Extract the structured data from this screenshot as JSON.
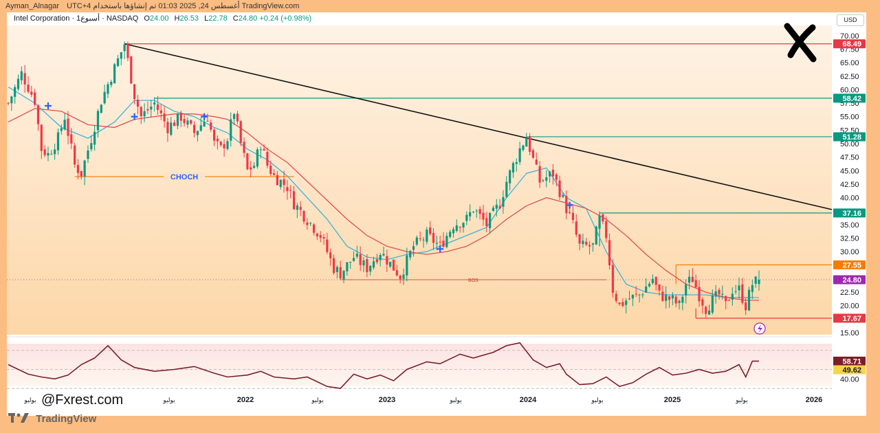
{
  "header": {
    "user": "Ayman_Alnagar",
    "info": "UTC+4 أغسطس 24, 2025 01:03 تم إنشاؤها باستخدام TradingView.com"
  },
  "legend": {
    "symbol": "Intel Corporation · 1أسبوع · NASDAQ",
    "o_label": "O",
    "o": "24.00",
    "h_label": "H",
    "h": "26.53",
    "l_label": "L",
    "l": "22.78",
    "c_label": "C",
    "c": "24.80",
    "change": "+0.24 (+0.98%)"
  },
  "currency": "USD",
  "watermark": "@Fxrest.com",
  "footer_brand": "TradingView",
  "colors": {
    "up": "#089981",
    "down": "#f23645",
    "ma_fast": "#3bb3d9",
    "ma_slow": "#e05050",
    "rsi": "#7b1e2a",
    "level_red": "#e53945",
    "level_teal": "#089981",
    "level_orange": "#f57c00"
  },
  "chart_data": {
    "type": "candlestick",
    "ylim": [
      15,
      71
    ],
    "y_ticks": [
      "15.00",
      "17.50",
      "20.00",
      "22.50",
      "25.00",
      "27.50",
      "30.00",
      "32.50",
      "35.00",
      "37.50",
      "40.00",
      "42.50",
      "45.00",
      "47.50",
      "50.00",
      "52.50",
      "55.00",
      "57.50",
      "60.00",
      "62.50",
      "65.00",
      "67.50",
      "70.00"
    ],
    "x_ticks": [
      "يوليو",
      "يوليو",
      "2022",
      "يوليو",
      "2023",
      "يوليو",
      "2024",
      "يوليو",
      "2025",
      "يوليو",
      "2026"
    ],
    "price_labels": [
      {
        "text": "68.49",
        "value": 68.49,
        "color": "#e53945"
      },
      {
        "text": "58.42",
        "value": 58.42,
        "color": "#089981"
      },
      {
        "text": "51.28",
        "value": 51.28,
        "color": "#089981"
      },
      {
        "text": "37.16",
        "value": 37.16,
        "color": "#089981"
      },
      {
        "text": "27.55",
        "value": 27.55,
        "color": "#f57c00"
      },
      {
        "text": "24.80",
        "value": 24.8,
        "color": "#9c27b0"
      },
      {
        "text": "17.67",
        "value": 17.67,
        "color": "#e53945"
      }
    ],
    "annotations": [
      {
        "text": "CHOCH",
        "value": 43.9
      },
      {
        "text": "BOS",
        "value": 24.8
      }
    ],
    "price_path": [
      [
        0,
        57.5
      ],
      [
        4,
        63
      ],
      [
        8,
        58
      ],
      [
        10,
        49
      ],
      [
        12,
        48
      ],
      [
        15,
        51
      ],
      [
        17,
        55
      ],
      [
        20,
        46
      ],
      [
        22,
        44.5
      ],
      [
        25,
        51
      ],
      [
        28,
        58
      ],
      [
        32,
        64
      ],
      [
        35,
        68.49
      ],
      [
        38,
        59
      ],
      [
        40,
        55
      ],
      [
        44,
        57.5
      ],
      [
        48,
        53
      ],
      [
        52,
        55
      ],
      [
        56,
        52
      ],
      [
        60,
        55
      ],
      [
        62,
        50
      ],
      [
        64,
        49
      ],
      [
        66,
        51
      ],
      [
        68,
        56
      ],
      [
        70,
        50
      ],
      [
        72,
        45
      ],
      [
        74,
        46
      ],
      [
        76,
        50
      ],
      [
        78,
        46
      ],
      [
        80,
        44
      ],
      [
        82,
        43
      ],
      [
        84,
        42
      ],
      [
        86,
        39
      ],
      [
        90,
        36
      ],
      [
        94,
        33
      ],
      [
        96,
        30
      ],
      [
        98,
        27
      ],
      [
        100,
        26
      ],
      [
        104,
        29
      ],
      [
        108,
        27
      ],
      [
        112,
        30
      ],
      [
        116,
        27
      ],
      [
        118,
        25.5
      ],
      [
        122,
        31
      ],
      [
        126,
        33
      ],
      [
        130,
        31
      ],
      [
        134,
        35
      ],
      [
        138,
        36
      ],
      [
        140,
        38
      ],
      [
        144,
        35
      ],
      [
        148,
        39
      ],
      [
        150,
        43
      ],
      [
        154,
        49
      ],
      [
        156,
        51.28
      ],
      [
        158,
        47
      ],
      [
        160,
        43
      ],
      [
        164,
        44.5
      ],
      [
        168,
        38
      ],
      [
        170,
        35
      ],
      [
        172,
        31
      ],
      [
        176,
        31
      ],
      [
        178,
        36
      ],
      [
        180,
        33
      ],
      [
        182,
        23
      ],
      [
        184,
        20
      ],
      [
        186,
        21
      ],
      [
        190,
        22
      ],
      [
        194,
        25
      ],
      [
        196,
        22
      ],
      [
        200,
        21
      ],
      [
        202,
        20
      ],
      [
        204,
        24
      ],
      [
        206,
        25
      ],
      [
        208,
        22
      ],
      [
        210,
        19.5
      ],
      [
        212,
        21
      ],
      [
        214,
        22
      ],
      [
        216,
        20
      ],
      [
        218,
        23
      ],
      [
        220,
        23
      ],
      [
        222,
        20
      ],
      [
        224,
        24
      ],
      [
        226,
        24.8
      ]
    ],
    "series": [
      {
        "name": "MA fast",
        "values": [
          [
            0,
            60.5
          ],
          [
            8,
            57.5
          ],
          [
            16,
            53
          ],
          [
            24,
            51
          ],
          [
            32,
            54
          ],
          [
            38,
            58
          ],
          [
            44,
            58
          ],
          [
            50,
            56
          ],
          [
            56,
            55
          ],
          [
            62,
            53
          ],
          [
            66,
            52
          ],
          [
            72,
            49
          ],
          [
            78,
            47
          ],
          [
            84,
            44
          ],
          [
            90,
            40
          ],
          [
            96,
            36
          ],
          [
            102,
            31
          ],
          [
            108,
            29
          ],
          [
            114,
            28.5
          ],
          [
            120,
            29.5
          ],
          [
            126,
            30
          ],
          [
            132,
            31.5
          ],
          [
            138,
            33
          ],
          [
            144,
            34.5
          ],
          [
            150,
            40
          ],
          [
            156,
            44.5
          ],
          [
            162,
            45.5
          ],
          [
            168,
            40
          ],
          [
            174,
            38
          ],
          [
            180,
            30
          ],
          [
            186,
            24
          ],
          [
            192,
            22.5
          ],
          [
            198,
            22
          ],
          [
            204,
            22
          ],
          [
            210,
            22
          ],
          [
            216,
            21.5
          ],
          [
            222,
            21.5
          ],
          [
            226,
            21.5
          ]
        ]
      },
      {
        "name": "MA slow",
        "values": [
          [
            0,
            54
          ],
          [
            8,
            56.5
          ],
          [
            16,
            56
          ],
          [
            24,
            53.5
          ],
          [
            32,
            53
          ],
          [
            38,
            54.5
          ],
          [
            44,
            55
          ],
          [
            50,
            55.5
          ],
          [
            56,
            55.5
          ],
          [
            62,
            55
          ],
          [
            66,
            54.5
          ],
          [
            72,
            52
          ],
          [
            78,
            49
          ],
          [
            84,
            46.5
          ],
          [
            90,
            43
          ],
          [
            96,
            39.5
          ],
          [
            102,
            36
          ],
          [
            108,
            33
          ],
          [
            114,
            31
          ],
          [
            120,
            30
          ],
          [
            126,
            29.5
          ],
          [
            132,
            30
          ],
          [
            138,
            31
          ],
          [
            144,
            33
          ],
          [
            150,
            36
          ],
          [
            156,
            38.5
          ],
          [
            162,
            40
          ],
          [
            168,
            39
          ],
          [
            174,
            38
          ],
          [
            180,
            36
          ],
          [
            186,
            33
          ],
          [
            192,
            29.5
          ],
          [
            198,
            26.5
          ],
          [
            204,
            24
          ],
          [
            210,
            22.5
          ],
          [
            216,
            21.5
          ],
          [
            222,
            21
          ],
          [
            226,
            21
          ]
        ]
      }
    ],
    "rsi": {
      "ylim": [
        25,
        80
      ],
      "label_value": "58.71",
      "ma_label": "49.62",
      "tick": "40.00",
      "values": [
        [
          0,
          55
        ],
        [
          6,
          45
        ],
        [
          10,
          42
        ],
        [
          14,
          40
        ],
        [
          18,
          44
        ],
        [
          22,
          55
        ],
        [
          26,
          62
        ],
        [
          30,
          75
        ],
        [
          34,
          60
        ],
        [
          38,
          52
        ],
        [
          44,
          48
        ],
        [
          50,
          50
        ],
        [
          56,
          53
        ],
        [
          62,
          46
        ],
        [
          66,
          42
        ],
        [
          72,
          44
        ],
        [
          76,
          48
        ],
        [
          80,
          42
        ],
        [
          86,
          40
        ],
        [
          90,
          42
        ],
        [
          96,
          32
        ],
        [
          100,
          30
        ],
        [
          104,
          45
        ],
        [
          108,
          40
        ],
        [
          112,
          44
        ],
        [
          116,
          38
        ],
        [
          120,
          50
        ],
        [
          126,
          58
        ],
        [
          130,
          56
        ],
        [
          136,
          66
        ],
        [
          140,
          62
        ],
        [
          146,
          68
        ],
        [
          150,
          75
        ],
        [
          154,
          78
        ],
        [
          158,
          60
        ],
        [
          162,
          52
        ],
        [
          166,
          56
        ],
        [
          168,
          45
        ],
        [
          172,
          34
        ],
        [
          176,
          35
        ],
        [
          180,
          42
        ],
        [
          184,
          32
        ],
        [
          188,
          36
        ],
        [
          192,
          45
        ],
        [
          196,
          52
        ],
        [
          200,
          44
        ],
        [
          204,
          46
        ],
        [
          208,
          50
        ],
        [
          212,
          46
        ],
        [
          216,
          48
        ],
        [
          220,
          55
        ],
        [
          222,
          42
        ],
        [
          224,
          58.71
        ],
        [
          226,
          58.71
        ]
      ]
    }
  }
}
